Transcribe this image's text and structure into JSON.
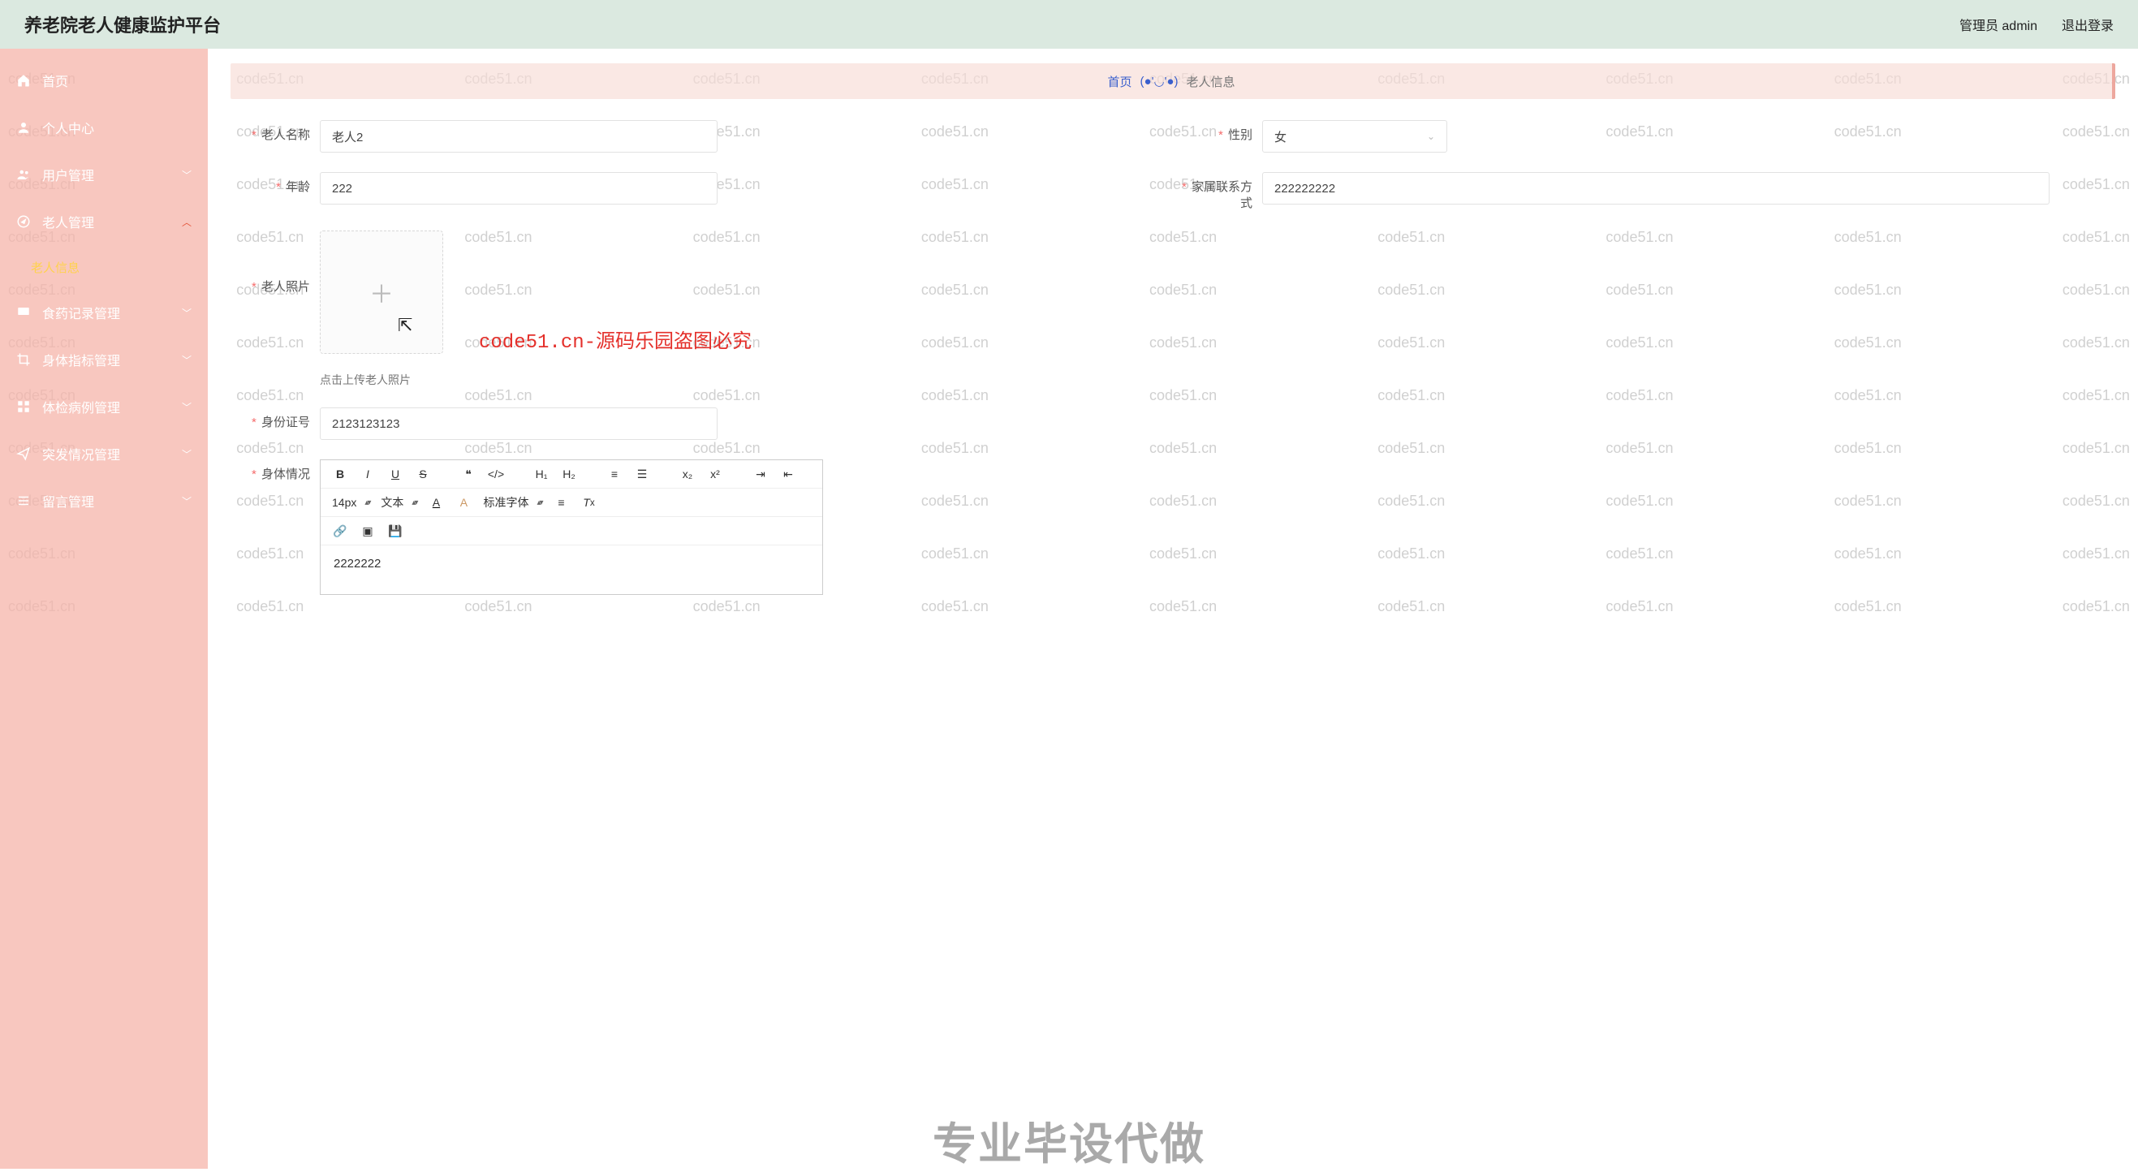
{
  "header": {
    "app_title": "养老院老人健康监护平台",
    "user_label": "管理员 admin",
    "logout_label": "退出登录"
  },
  "sidebar": {
    "items": [
      {
        "label": "首页",
        "icon": "home"
      },
      {
        "label": "个人中心",
        "icon": "user"
      },
      {
        "label": "用户管理",
        "icon": "users",
        "expandable": true
      },
      {
        "label": "老人管理",
        "icon": "compass",
        "expandable": true,
        "expanded": true
      },
      {
        "label": "食药记录管理",
        "icon": "monitor",
        "expandable": true
      },
      {
        "label": "身体指标管理",
        "icon": "crop",
        "expandable": true
      },
      {
        "label": "体检病例管理",
        "icon": "grid",
        "expandable": true
      },
      {
        "label": "突发情况管理",
        "icon": "send",
        "expandable": true
      },
      {
        "label": "留言管理",
        "icon": "list",
        "expandable": true
      }
    ],
    "sub_active": "老人信息"
  },
  "breadcrumb": {
    "home": "首页",
    "face": "(●'◡'●)",
    "current": "老人信息"
  },
  "form": {
    "name": {
      "label": "老人名称",
      "value": "老人2"
    },
    "gender": {
      "label": "性别",
      "value": "女"
    },
    "age": {
      "label": "年龄",
      "value": "222"
    },
    "contact": {
      "label": "家属联系方式",
      "value": "222222222"
    },
    "photo": {
      "label": "老人照片",
      "hint": "点击上传老人照片"
    },
    "idnum": {
      "label": "身份证号",
      "value": "2123123123"
    },
    "body": {
      "label": "身体情况"
    }
  },
  "editor": {
    "fontsize": "14px",
    "style_text": "文本",
    "font_family": "标准字体",
    "content": "2222222"
  },
  "watermark": "code51.cn",
  "overlay": {
    "anti": "code51.cn-源码乐园盗图必究",
    "footer": "专业毕设代做"
  }
}
